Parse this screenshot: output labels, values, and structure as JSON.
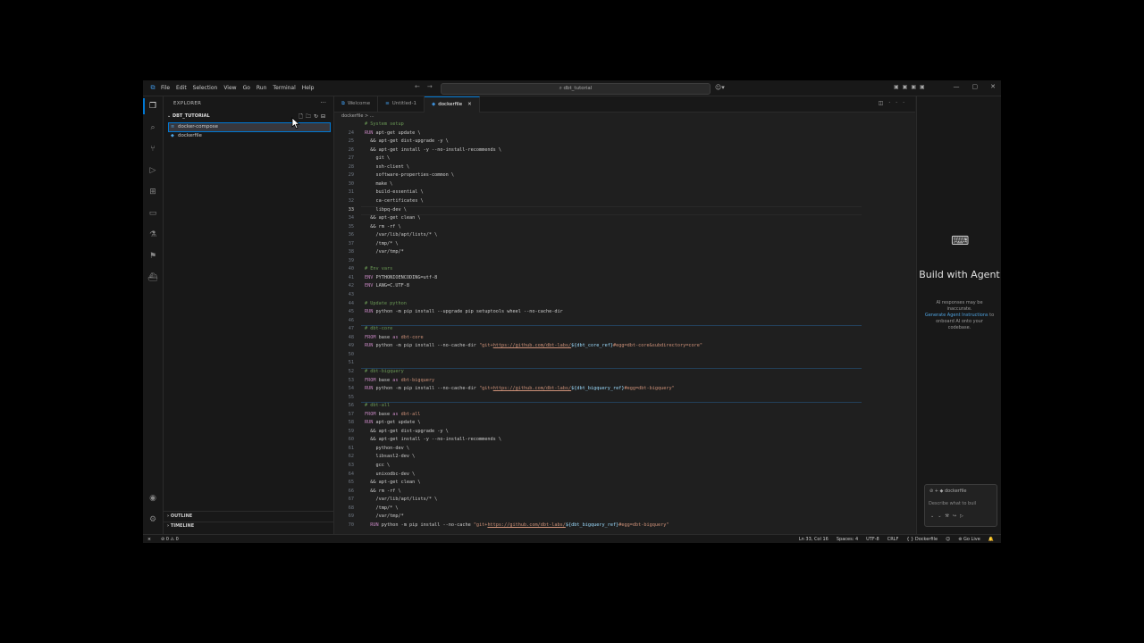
{
  "menu": [
    "File",
    "Edit",
    "Selection",
    "View",
    "Go",
    "Run",
    "Terminal",
    "Help"
  ],
  "command_center": "dbt_tutorial",
  "explorer": {
    "title": "EXPLORER",
    "folder": "DBT_TUTORIAL",
    "files": [
      {
        "name": "docker-compose",
        "selected": true
      },
      {
        "name": "dockerfile",
        "selected": false
      }
    ],
    "outline": "OUTLINE",
    "timeline": "TIMELINE"
  },
  "tabs": [
    {
      "label": "Welcome",
      "active": false
    },
    {
      "label": "Untitled-1",
      "active": false
    },
    {
      "label": "dockerfile",
      "active": true
    }
  ],
  "breadcrumb": "dockerfile > ...",
  "code": [
    {
      "n": "",
      "t": [
        [
          "cm",
          "# System setup"
        ]
      ]
    },
    {
      "n": "24",
      "t": [
        [
          "kw",
          "RUN"
        ],
        [
          "",
          " apt-get update \\"
        ]
      ]
    },
    {
      "n": "25",
      "t": [
        [
          "",
          "  && apt-get dist-upgrade -y \\"
        ]
      ]
    },
    {
      "n": "26",
      "t": [
        [
          "",
          "  && apt-get install -y --no-install-recommends \\"
        ]
      ]
    },
    {
      "n": "27",
      "t": [
        [
          "",
          "    git \\"
        ]
      ]
    },
    {
      "n": "28",
      "t": [
        [
          "",
          "    ssh-client \\"
        ]
      ]
    },
    {
      "n": "29",
      "t": [
        [
          "",
          "    software-properties-common \\"
        ]
      ]
    },
    {
      "n": "30",
      "t": [
        [
          "",
          "    make \\"
        ]
      ]
    },
    {
      "n": "31",
      "t": [
        [
          "",
          "    build-essential \\"
        ]
      ]
    },
    {
      "n": "32",
      "t": [
        [
          "",
          "    ca-certificates \\"
        ]
      ]
    },
    {
      "n": "33",
      "t": [
        [
          "",
          "    libpq-dev \\"
        ]
      ]
    },
    {
      "n": "34",
      "t": [
        [
          "",
          "  && apt-get clean \\"
        ]
      ]
    },
    {
      "n": "35",
      "t": [
        [
          "",
          "  && rm -rf \\"
        ]
      ]
    },
    {
      "n": "36",
      "t": [
        [
          "",
          "    /var/lib/apt/lists/* \\"
        ]
      ]
    },
    {
      "n": "37",
      "t": [
        [
          "",
          "    /tmp/* \\"
        ]
      ]
    },
    {
      "n": "38",
      "t": [
        [
          "",
          "    /var/tmp/*"
        ]
      ]
    },
    {
      "n": "39",
      "t": []
    },
    {
      "n": "40",
      "t": [
        [
          "cm",
          "# Env vars"
        ]
      ]
    },
    {
      "n": "41",
      "t": [
        [
          "kw",
          "ENV"
        ],
        [
          "",
          " PYTHONIOENCODING=utf-8"
        ]
      ]
    },
    {
      "n": "42",
      "t": [
        [
          "kw",
          "ENV"
        ],
        [
          "",
          " LANG=C.UTF-8"
        ]
      ]
    },
    {
      "n": "43",
      "t": []
    },
    {
      "n": "44",
      "t": [
        [
          "cm",
          "# Update python"
        ]
      ]
    },
    {
      "n": "45",
      "t": [
        [
          "kw",
          "RUN"
        ],
        [
          "",
          " python -m pip install --upgrade pip setuptools wheel --no-cache-dir"
        ]
      ]
    },
    {
      "n": "46",
      "t": []
    },
    {
      "n": "47",
      "t": [
        [
          "cm",
          "# dbt-core"
        ]
      ]
    },
    {
      "n": "48",
      "t": [
        [
          "kw",
          "FROM"
        ],
        [
          "",
          " base "
        ],
        [
          "kw",
          "as"
        ],
        [
          "",
          " "
        ],
        [
          "str",
          "dbt-core"
        ]
      ]
    },
    {
      "n": "49",
      "t": [
        [
          "kw",
          "RUN"
        ],
        [
          "",
          " python -m pip install --no-cache-dir "
        ],
        [
          "str",
          "\"git+"
        ],
        [
          "link",
          "https://github.com/dbt-labs/"
        ],
        [
          "var",
          "${dbt_core_ref}"
        ],
        [
          "str",
          "#egg=dbt-core&subdirectory=core\""
        ]
      ]
    },
    {
      "n": "50",
      "t": []
    },
    {
      "n": "51",
      "t": []
    },
    {
      "n": "52",
      "t": [
        [
          "cm",
          "# dbt-bigquery"
        ]
      ]
    },
    {
      "n": "53",
      "t": [
        [
          "kw",
          "FROM"
        ],
        [
          "",
          " base "
        ],
        [
          "kw",
          "as"
        ],
        [
          "",
          " "
        ],
        [
          "str",
          "dbt-bigquery"
        ]
      ]
    },
    {
      "n": "54",
      "t": [
        [
          "kw",
          "RUN"
        ],
        [
          "",
          " python -m pip install --no-cache-dir "
        ],
        [
          "str",
          "\"git+"
        ],
        [
          "link",
          "https://github.com/dbt-labs/"
        ],
        [
          "var",
          "${dbt_bigquery_ref}"
        ],
        [
          "str",
          "#egg=dbt-bigquery\""
        ]
      ]
    },
    {
      "n": "55",
      "t": []
    },
    {
      "n": "56",
      "t": [
        [
          "cm",
          "# dbt-all"
        ]
      ]
    },
    {
      "n": "57",
      "t": [
        [
          "kw",
          "FROM"
        ],
        [
          "",
          " base "
        ],
        [
          "kw",
          "as"
        ],
        [
          "",
          " "
        ],
        [
          "str",
          "dbt-all"
        ]
      ]
    },
    {
      "n": "58",
      "t": [
        [
          "kw",
          "RUN"
        ],
        [
          "",
          " apt-get update \\"
        ]
      ]
    },
    {
      "n": "59",
      "t": [
        [
          "",
          "  && apt-get dist-upgrade -y \\"
        ]
      ]
    },
    {
      "n": "60",
      "t": [
        [
          "",
          "  && apt-get install -y --no-install-recommends \\"
        ]
      ]
    },
    {
      "n": "61",
      "t": [
        [
          "",
          "    python-dev \\"
        ]
      ]
    },
    {
      "n": "62",
      "t": [
        [
          "",
          "    libsasl2-dev \\"
        ]
      ]
    },
    {
      "n": "63",
      "t": [
        [
          "",
          "    gcc \\"
        ]
      ]
    },
    {
      "n": "64",
      "t": [
        [
          "",
          "    unixodbc-dev \\"
        ]
      ]
    },
    {
      "n": "65",
      "t": [
        [
          "",
          "  && apt-get clean \\"
        ]
      ]
    },
    {
      "n": "66",
      "t": [
        [
          "",
          "  && rm -rf \\"
        ]
      ]
    },
    {
      "n": "67",
      "t": [
        [
          "",
          "    /var/lib/apt/lists/* \\"
        ]
      ]
    },
    {
      "n": "68",
      "t": [
        [
          "",
          "    /tmp/* \\"
        ]
      ]
    },
    {
      "n": "69",
      "t": [
        [
          "",
          "    /var/tmp/*"
        ]
      ]
    },
    {
      "n": "70",
      "t": [
        [
          "kw",
          "  RUN"
        ],
        [
          "",
          " python -m pip install --no-cache "
        ],
        [
          "str",
          "\"git+"
        ],
        [
          "link",
          "https://github.com/dbt-labs/"
        ],
        [
          "var",
          "${dbt_bigquery_ref}"
        ],
        [
          "str",
          "#egg=dbt-bigquery\""
        ]
      ]
    }
  ],
  "current_line": "33",
  "agent": {
    "title": "Build with Agent",
    "note": "AI responses may be inaccurate.",
    "link": "Generate Agent Instructions",
    "note2": " to onboard AI onto your codebase.",
    "chip": "dockerfile",
    "placeholder": "Describe what to buil"
  },
  "status": {
    "problems": "⊘ 0 ⚠ 0",
    "position": "Ln 33, Col 16",
    "spaces": "Spaces: 4",
    "encoding": "UTF-8",
    "eol": "CRLF",
    "language": "{ } Dockerfile",
    "golive": "Go Live"
  }
}
